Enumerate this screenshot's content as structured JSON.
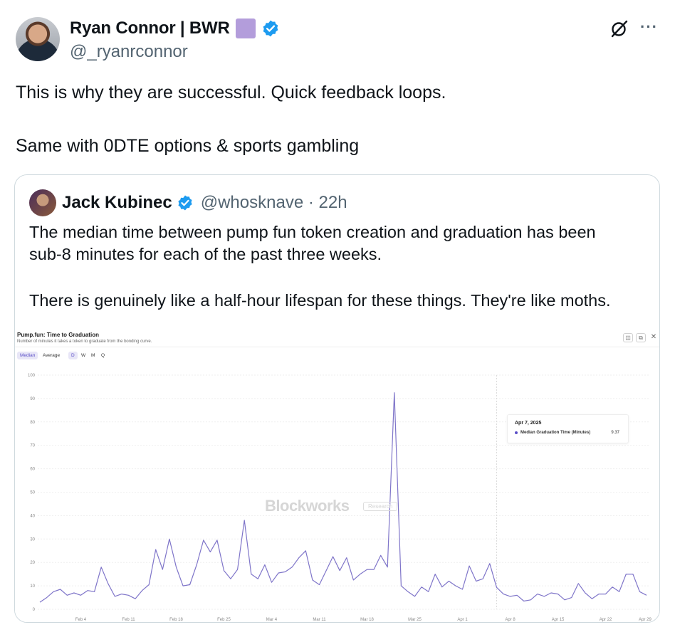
{
  "author": {
    "name": "Ryan Connor | BWR",
    "handle": "@_ryanrconnor",
    "badge_color": "#b39ddb",
    "verified_color": "#1d9bf0"
  },
  "post": {
    "line1": "This is why they are successful. Quick feedback loops.",
    "line2": "Same with 0DTE options & sports gambling"
  },
  "quote": {
    "name": "Jack Kubinec",
    "handle": "@whosknave · 22h",
    "line1": "The median time between pump fun token creation and graduation has been",
    "line2": "sub-8 minutes for each of the past three weeks.",
    "line3": "There is genuinely like a half-hour lifespan for these things. They're like moths."
  },
  "chart_header": {
    "title": "Pump.fun: Time to Graduation",
    "subtitle": "Number of minutes it takes a token to graduate from the bonding curve.",
    "toggle_median": "Median",
    "toggle_average": "Average",
    "period_d": "D",
    "period_w": "W",
    "period_m": "M",
    "period_q": "Q",
    "watermark": "Blockworks",
    "watermark_tag": "Research"
  },
  "tooltip": {
    "date": "Apr 7, 2025",
    "series": "Median Graduation Time (Minutes)",
    "value": "9.37"
  },
  "chart_data": {
    "type": "line",
    "title": "Pump.fun: Time to Graduation",
    "ylim": [
      0,
      100
    ],
    "yticks": [
      0,
      10,
      20,
      30,
      40,
      50,
      60,
      70,
      80,
      90,
      100
    ],
    "xticks": [
      "Feb 4",
      "Feb 11",
      "Feb 18",
      "Feb 25",
      "Mar 4",
      "Mar 11",
      "Mar 18",
      "Mar 25",
      "Apr 1",
      "Apr 8",
      "Apr 15",
      "Apr 22",
      "Apr 29"
    ],
    "series_color": "#7f75c9",
    "series": [
      {
        "name": "Median Graduation Time (Minutes)",
        "values": [
          3,
          5,
          7.5,
          8.5,
          6,
          7,
          6,
          8,
          7.5,
          18,
          11,
          5.5,
          6.5,
          6,
          4.5,
          8,
          10.5,
          25.5,
          17,
          30,
          18,
          10,
          10.5,
          19,
          29.5,
          24.5,
          29.5,
          16.5,
          13,
          17,
          38,
          15,
          13,
          19,
          11.5,
          15.5,
          16,
          18,
          22,
          25,
          12.5,
          10.5,
          16.5,
          22.5,
          16.5,
          22,
          12.5,
          15,
          17,
          17,
          23,
          18,
          92.5,
          10,
          7.5,
          5.5,
          9.5,
          7.5,
          15,
          9.5,
          12,
          10,
          8.5,
          18.5,
          12,
          13,
          19.5,
          9.37,
          6.5,
          5.5,
          6,
          3.5,
          4,
          6.5,
          5.5,
          7,
          6.5,
          4,
          5,
          11,
          7,
          4.5,
          6.5,
          6.5,
          9.5,
          7.5,
          15,
          15,
          7.5,
          6
        ]
      }
    ]
  }
}
